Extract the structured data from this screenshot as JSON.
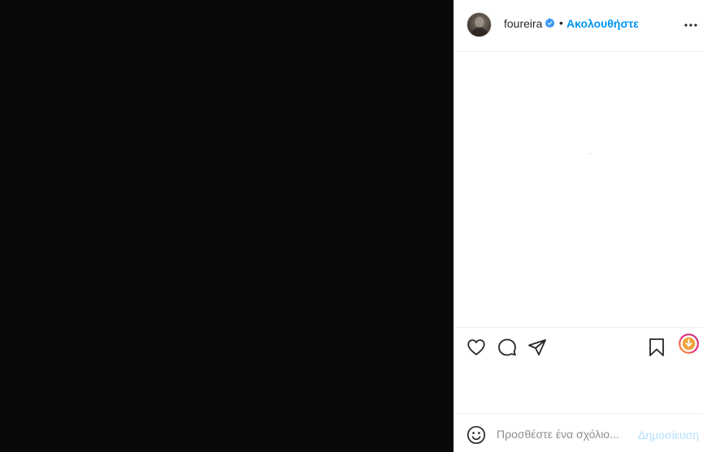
{
  "post": {
    "media": {
      "type": "image",
      "background": "#0b0908"
    },
    "header": {
      "username": "foureira",
      "verified": true,
      "separator": "•",
      "follow_label": "Ακολουθήστε",
      "more_icon": "more-options-icon"
    },
    "actions": {
      "like_icon": "heart-icon",
      "comment_icon": "comment-icon",
      "share_icon": "send-icon",
      "save_icon": "bookmark-icon",
      "extra_icon": "circular-badge-icon"
    },
    "comment_box": {
      "emoji_icon": "emoji-icon",
      "placeholder": "Προσθέστε ένα σχόλιο...",
      "post_label": "Δημοσίευση"
    }
  },
  "colors": {
    "accent": "#0095f6",
    "post_disabled": "#b2dffc",
    "media_bg": "#0b0908",
    "text": "#262626",
    "placeholder": "#8e8e8e",
    "divider": "#efefef"
  }
}
